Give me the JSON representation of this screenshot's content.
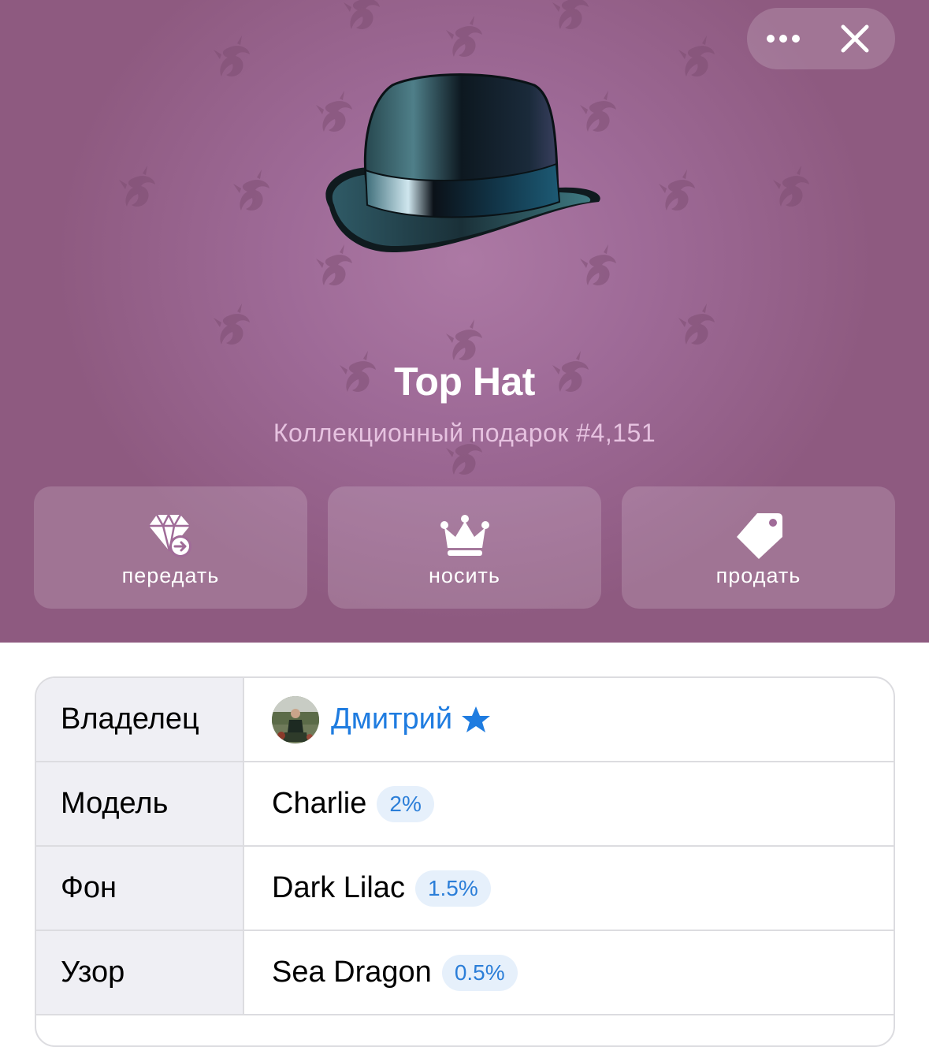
{
  "header": {
    "title": "Top Hat",
    "subtitle": "Коллекционный подарок #4,151"
  },
  "top_controls": {
    "more_icon": "ellipsis-icon",
    "close_icon": "close-icon"
  },
  "actions": [
    {
      "label": "передать",
      "icon": "diamond-transfer-icon"
    },
    {
      "label": "носить",
      "icon": "crown-icon"
    },
    {
      "label": "продать",
      "icon": "price-tag-icon"
    }
  ],
  "details": {
    "rows": [
      {
        "key": "Владелец",
        "value": "Дмитрий",
        "badge": ""
      },
      {
        "key": "Модель",
        "value": "Charlie",
        "badge": "2%"
      },
      {
        "key": "Фон",
        "value": "Dark Lilac",
        "badge": "1.5%"
      },
      {
        "key": "Узор",
        "value": "Sea Dragon",
        "badge": "0.5%"
      }
    ]
  },
  "colors": {
    "background": "#9e6a97",
    "link": "#1f7ce0",
    "badge_bg": "#e6f0fb",
    "badge_text": "#2b7ed8"
  }
}
